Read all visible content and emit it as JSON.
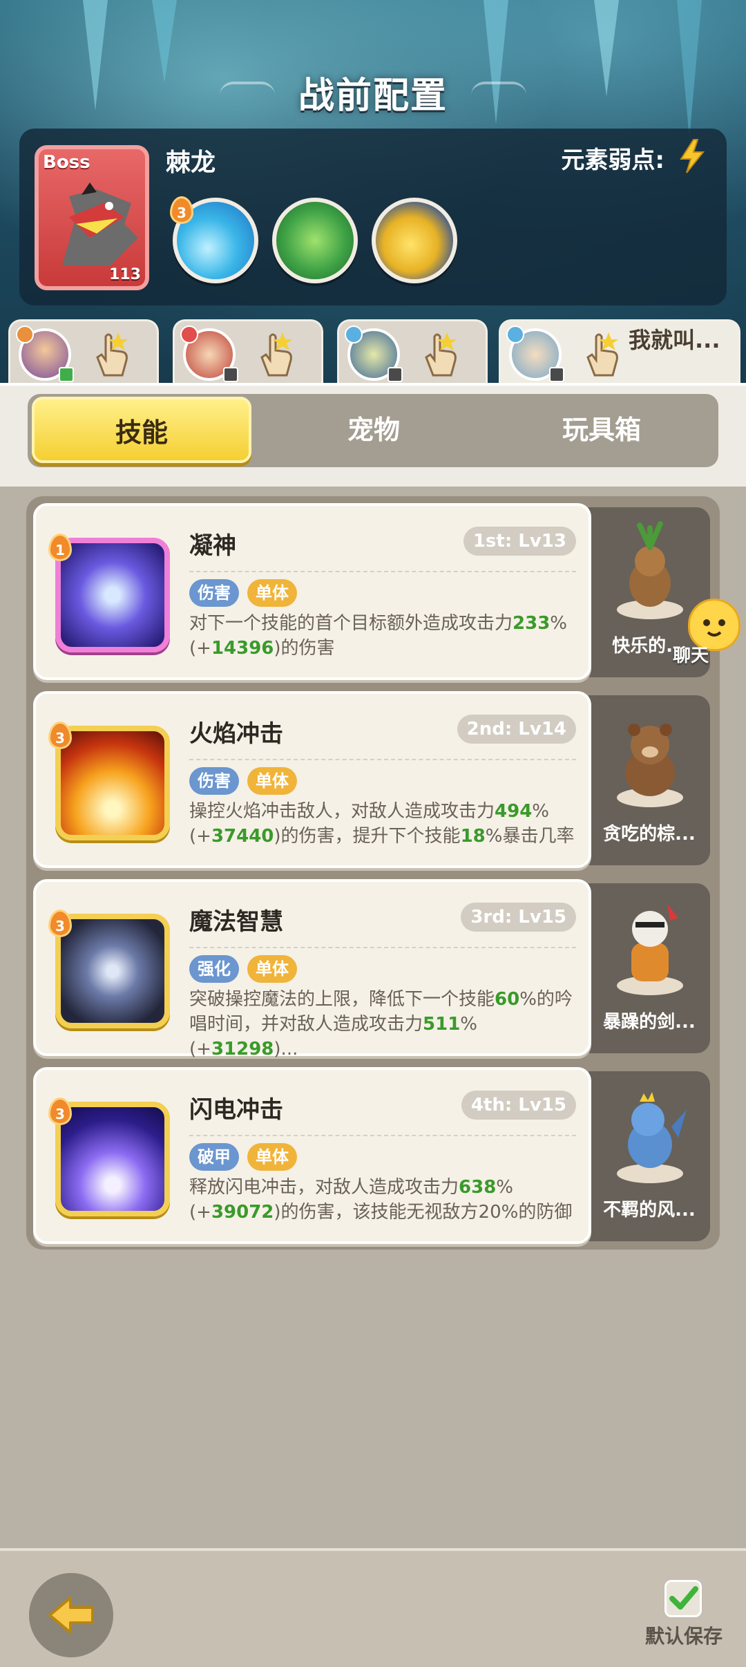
{
  "page": {
    "title": "战前配置"
  },
  "boss": {
    "tag": "Boss",
    "name": "棘龙",
    "level": "113",
    "weakness_label": "元素弱点:",
    "weakness_icon": "lightning-icon",
    "skill_badge": "3"
  },
  "heroes": [
    {
      "id": "hero-1",
      "label": ""
    },
    {
      "id": "hero-2",
      "label": ""
    },
    {
      "id": "hero-3",
      "label": ""
    },
    {
      "id": "hero-4",
      "label": "我就叫..."
    }
  ],
  "tabs": {
    "skill": "技能",
    "pet": "宠物",
    "toybox": "玩具箱"
  },
  "skills": [
    {
      "badge": "1",
      "name": "凝神",
      "rank": "1st: Lv13",
      "tags": [
        "伤害",
        "单体"
      ],
      "desc_parts": [
        "对下一个技能的首个目标额外造成攻击力",
        "233",
        "%(+",
        "14396",
        ")的伤害"
      ],
      "pet_name": "快乐的..."
    },
    {
      "badge": "3",
      "name": "火焰冲击",
      "rank": "2nd: Lv14",
      "tags": [
        "伤害",
        "单体"
      ],
      "desc_parts": [
        "操控火焰冲击敌人，对敌人造成攻击力",
        "494",
        "%(+",
        "37440",
        ")的伤害，提升下个技能",
        "18",
        "%暴击几率"
      ],
      "pet_name": "贪吃的棕..."
    },
    {
      "badge": "3",
      "name": "魔法智慧",
      "rank": "3rd: Lv15",
      "tags": [
        "强化",
        "单体"
      ],
      "desc_parts": [
        "突破操控魔法的上限，降低下一个技能",
        "60",
        "%的吟唱时间，并对敌人造成攻击力",
        "511",
        "%(+",
        "31298",
        ")..."
      ],
      "pet_name": "暴躁的剑..."
    },
    {
      "badge": "3",
      "name": "闪电冲击",
      "rank": "4th: Lv15",
      "tags": [
        "破甲",
        "单体"
      ],
      "desc_parts": [
        "释放闪电冲击，对敌人造成攻击力",
        "638",
        "%(+",
        "39072",
        ")的伤害，该技能无视敌方20%的防御"
      ],
      "pet_name": "不羁的风..."
    }
  ],
  "chat": {
    "label": "聊天"
  },
  "footer": {
    "save_label": "默认保存"
  },
  "colors": {
    "accent_yellow": "#f5cf33",
    "green_value": "#3a9a2a",
    "tag_blue": "#6b96cf",
    "tag_orange": "#f0b43a"
  }
}
